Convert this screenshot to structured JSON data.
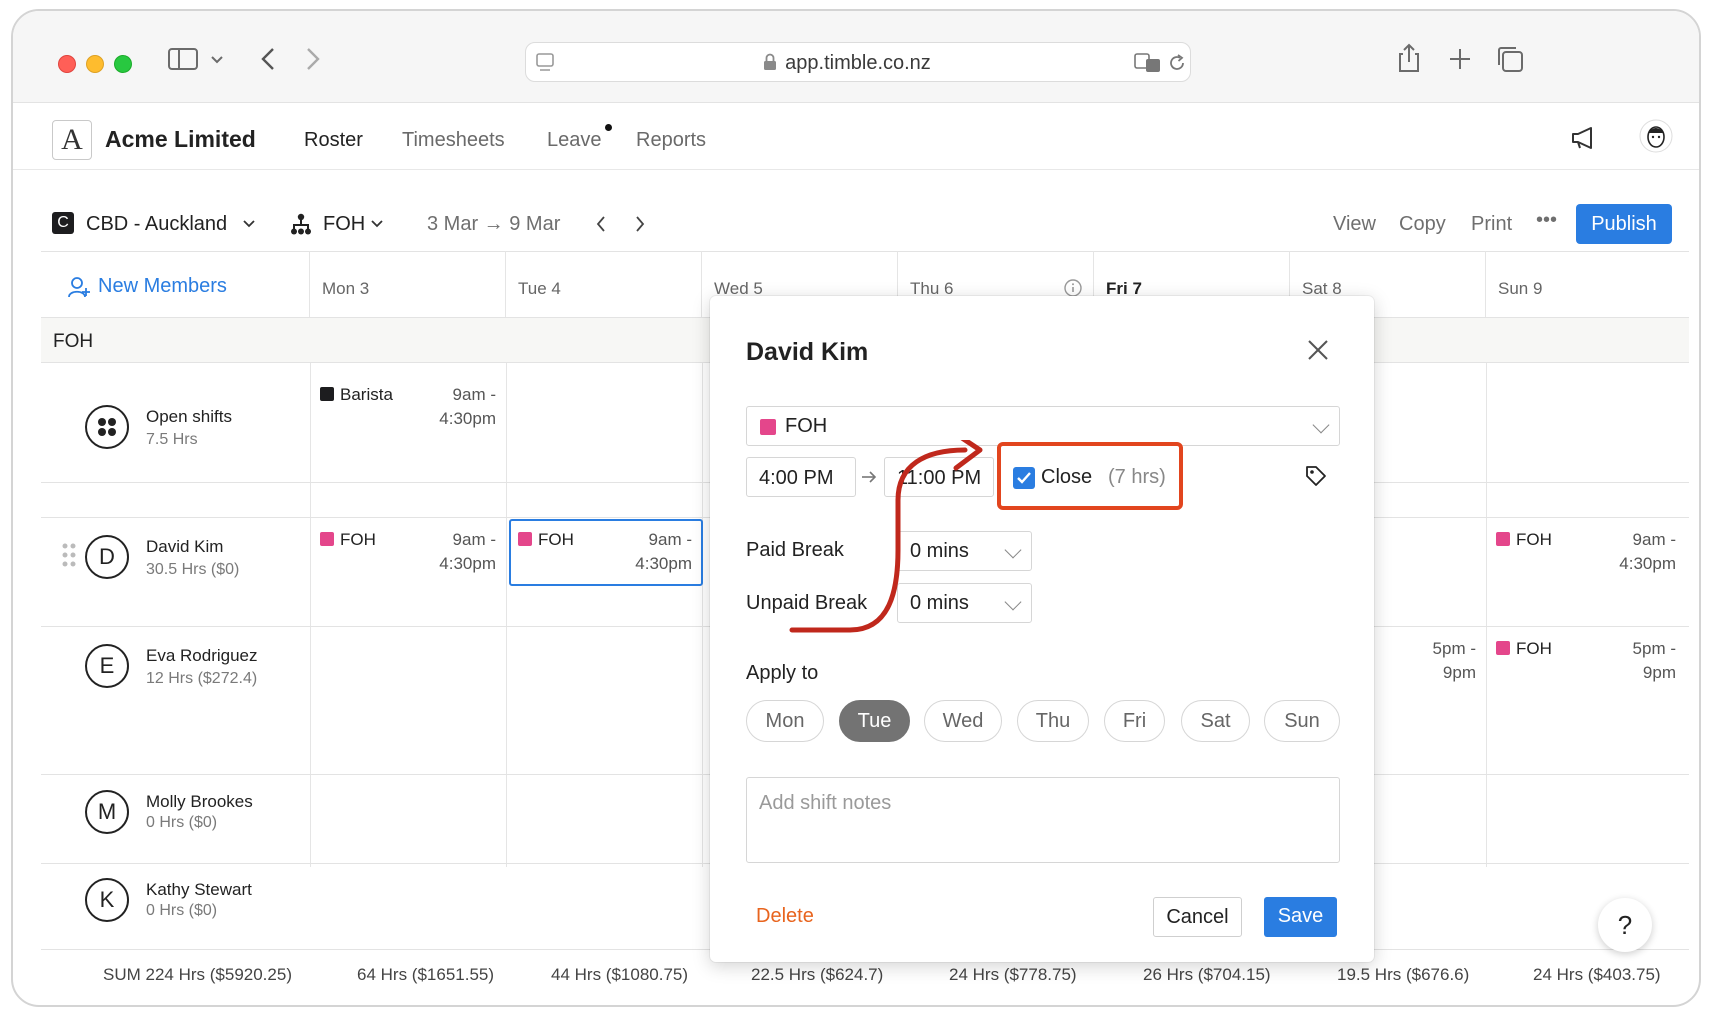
{
  "browser": {
    "url": "app.timble.co.nz"
  },
  "header": {
    "logo_letter": "A",
    "company": "Acme Limited",
    "tabs": [
      {
        "label": "Roster"
      },
      {
        "label": "Timesheets"
      },
      {
        "label": "Leave"
      },
      {
        "label": "Reports"
      }
    ]
  },
  "toolbar": {
    "location_badge": "C",
    "location": "CBD - Auckland",
    "team": "FOH",
    "date_range": "3 Mar → 9 Mar",
    "view": "View",
    "copy": "Copy",
    "print": "Print",
    "more": "•••",
    "publish": "Publish"
  },
  "roster": {
    "new_members": "New Members",
    "days": [
      "Mon 3",
      "Tue 4",
      "Wed 5",
      "Thu 6",
      "Fri 7",
      "Sat 8",
      "Sun 9"
    ],
    "section": "FOH",
    "rows": [
      {
        "avatar": "",
        "name": "Open shifts",
        "sub": "7.5 Hrs"
      },
      {
        "avatar": "D",
        "name": "David Kim",
        "sub": "30.5 Hrs ($0)"
      },
      {
        "avatar": "E",
        "name": "Eva Rodriguez",
        "sub": "12 Hrs ($272.4)"
      },
      {
        "avatar": "M",
        "name": "Molly Brookes",
        "sub": "0 Hrs ($0)"
      },
      {
        "avatar": "K",
        "name": "Kathy Stewart",
        "sub": "0 Hrs ($0)"
      }
    ],
    "shifts": {
      "open_mon": {
        "role": "Barista",
        "time1": "9am -",
        "time2": "4:30pm"
      },
      "david_mon": {
        "role": "FOH",
        "time1": "9am -",
        "time2": "4:30pm"
      },
      "david_tue": {
        "role": "FOH",
        "time1": "9am -",
        "time2": "4:30pm"
      },
      "david_sun": {
        "role": "FOH",
        "time1": "9am -",
        "time2": "4:30pm"
      },
      "eva_sat": {
        "time1": "5pm -",
        "time2": "9pm"
      },
      "eva_sun": {
        "role": "FOH",
        "time1": "5pm -",
        "time2": "9pm"
      }
    },
    "sums": [
      "SUM 224 Hrs ($5920.25)",
      "64 Hrs ($1651.55)",
      "44 Hrs ($1080.75)",
      "22.5 Hrs ($624.7)",
      "24 Hrs ($778.75)",
      "26 Hrs ($704.15)",
      "19.5 Hrs ($676.6)",
      "24 Hrs ($403.75)"
    ]
  },
  "modal": {
    "title": "David Kim",
    "area": "FOH",
    "start_time": "4:00 PM",
    "end_time": "11:00 PM",
    "close_label": "Close",
    "close_hours": "(7 hrs)",
    "paid_break_label": "Paid Break",
    "paid_break_value": "0 mins",
    "unpaid_break_label": "Unpaid Break",
    "unpaid_break_value": "0 mins",
    "apply_to_label": "Apply to",
    "days": [
      "Mon",
      "Tue",
      "Wed",
      "Thu",
      "Fri",
      "Sat",
      "Sun"
    ],
    "selected_day": "Tue",
    "notes_placeholder": "Add shift notes",
    "delete": "Delete",
    "cancel": "Cancel",
    "save": "Save"
  },
  "help": "?",
  "colors": {
    "accent": "#2a7de1",
    "foh": "#e4468b",
    "barista": "#1d1d1f",
    "annotation": "#e2451e",
    "arrow": "#c0281c"
  },
  "icons": [
    "sidebar-icon",
    "back-icon",
    "forward-icon",
    "lock-icon",
    "translate-icon",
    "reload-icon",
    "share-icon",
    "new-tab-icon",
    "tabs-icon",
    "megaphone-icon",
    "user-avatar-icon",
    "team-icon",
    "person-add-icon",
    "info-icon",
    "close-icon",
    "tag-icon",
    "drag-handle-icon"
  ]
}
